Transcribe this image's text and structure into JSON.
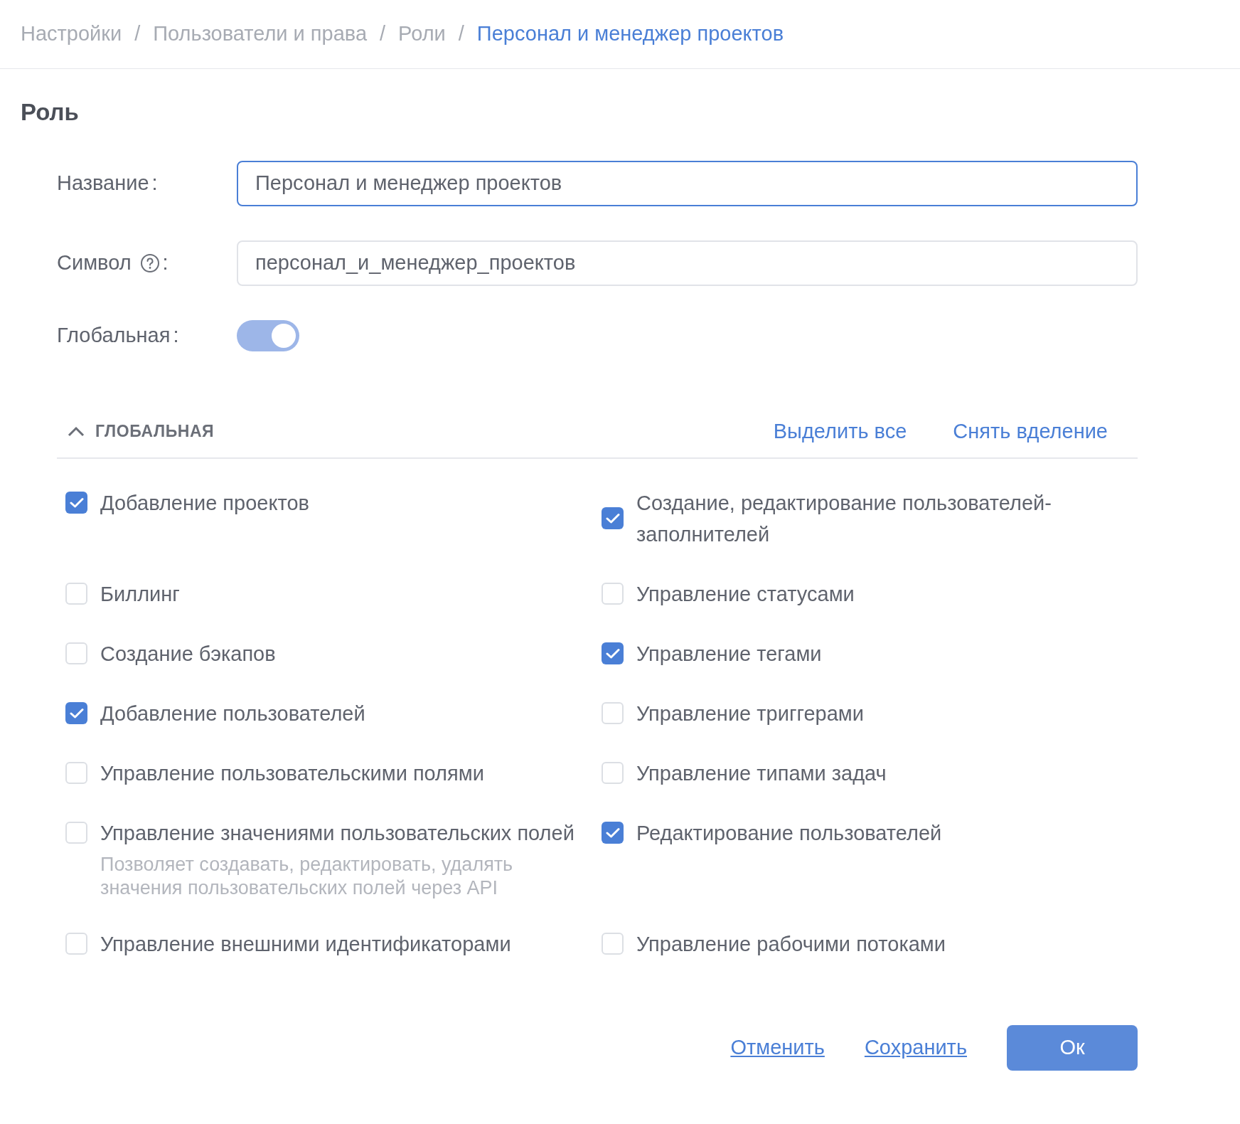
{
  "breadcrumb": [
    {
      "label": "Настройки",
      "current": false
    },
    {
      "label": "Пользователи и права",
      "current": false
    },
    {
      "label": "Роли",
      "current": false
    },
    {
      "label": "Персонал и менеджер проектов",
      "current": true
    }
  ],
  "separator": "/",
  "title": "Роль",
  "fields": [
    {
      "kind": "text",
      "label": "Название",
      "colon": ":",
      "value": "Персонал и менеджер проектов",
      "focused": true,
      "help": false
    },
    {
      "kind": "text",
      "label": "Символ",
      "colon": ":",
      "value": "персонал_и_менеджер_проектов",
      "focused": false,
      "help": true
    },
    {
      "kind": "toggle",
      "label": "Глобальная",
      "colon": ":",
      "on": true
    }
  ],
  "section": {
    "title": "ГЛОБАЛЬНАЯ",
    "expanded": true,
    "actions": [
      "Выделить все",
      "Снять вделение"
    ]
  },
  "permissions": [
    {
      "label": "Добавление проектов",
      "checked": true
    },
    {
      "label": "Создание, редактирование пользователей-заполнителей",
      "checked": true
    },
    {
      "label": "Биллинг",
      "checked": false
    },
    {
      "label": "Управление статусами",
      "checked": false
    },
    {
      "label": "Создание бэкапов",
      "checked": false
    },
    {
      "label": "Управление тегами",
      "checked": true
    },
    {
      "label": "Добавление пользователей",
      "checked": true
    },
    {
      "label": "Управление триггерами",
      "checked": false
    },
    {
      "label": "Управление пользовательскими полями",
      "checked": false
    },
    {
      "label": "Управление типами задач",
      "checked": false
    },
    {
      "label": "Управление значениями пользовательских полей",
      "checked": false,
      "description": "Позволяет создавать, редактировать, удалять значения пользовательских полей через API"
    },
    {
      "label": "Редактирование пользователей",
      "checked": true
    },
    {
      "label": "Управление внешними идентификаторами",
      "checked": false
    },
    {
      "label": "Управление рабочими потоками",
      "checked": false
    }
  ],
  "footer": {
    "links": [
      "Отменить",
      "Сохранить"
    ],
    "primary": "Ок"
  }
}
